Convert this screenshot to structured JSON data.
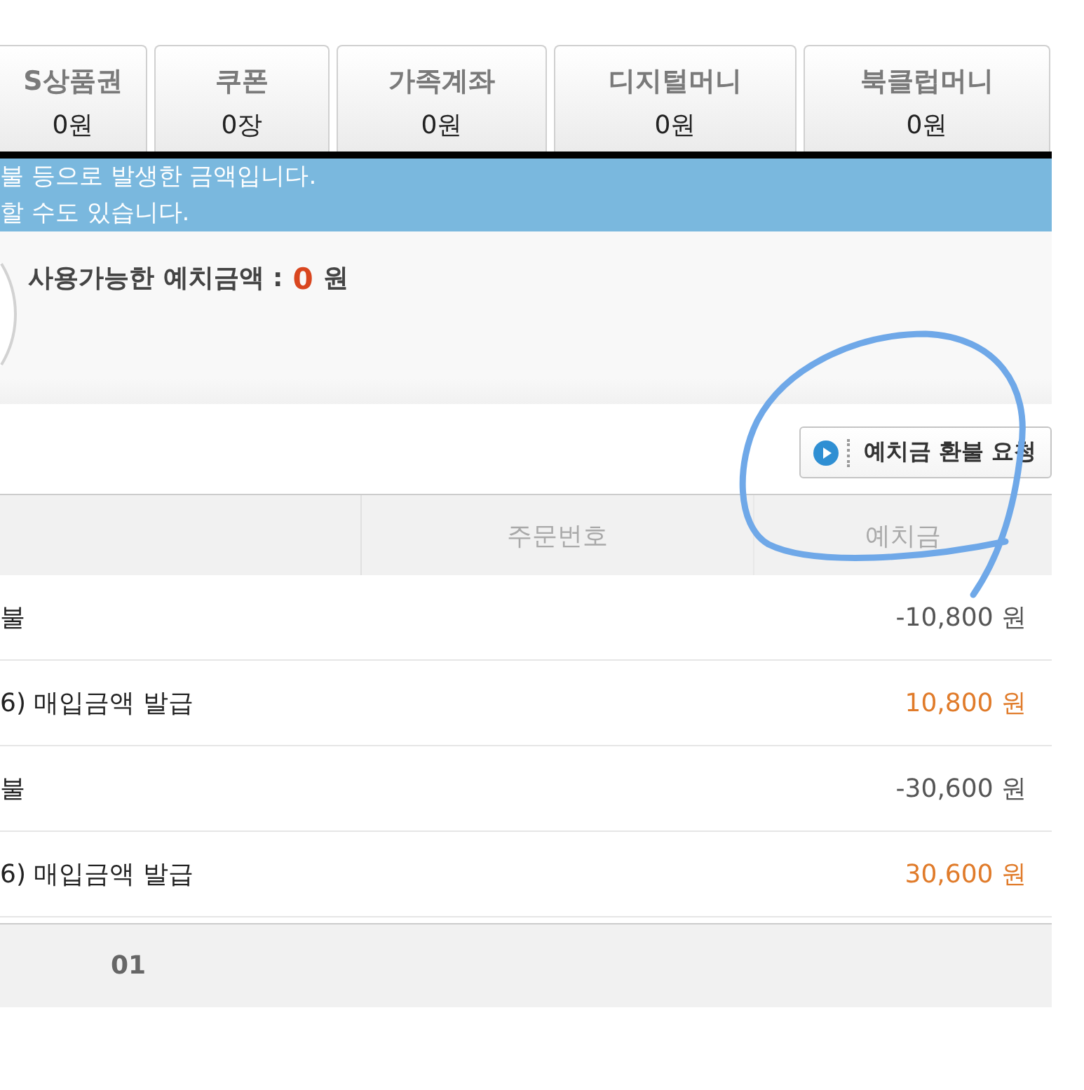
{
  "tabs": [
    {
      "label": "S상품권",
      "value": "0원",
      "selected": false
    },
    {
      "label": "쿠폰",
      "value": "0장",
      "selected": false
    },
    {
      "label": "가족계좌",
      "value": "0원",
      "selected": false
    },
    {
      "label": "디지털머니",
      "value": "0원",
      "selected": false
    },
    {
      "label": "북클럽머니",
      "value": "0원",
      "selected": false
    }
  ],
  "notice": {
    "lines": [
      "불 등으로 발생한 금액입니다.",
      "할 수도 있습니다."
    ]
  },
  "balance": {
    "label": "사용가능한 예치금액 :",
    "amount": "0",
    "unit": "원"
  },
  "refund_button": {
    "label": "예치금 환불 요청"
  },
  "table": {
    "columns": [
      "주문번호",
      "예치금"
    ],
    "rows": [
      {
        "column_1": "불",
        "amount": "-10,800 원",
        "color": "#555555"
      },
      {
        "column_1": "6) 매입금액 발급",
        "amount": "10,800 원",
        "color": "#e07b2a"
      },
      {
        "column_1": "불",
        "amount": "-30,600 원",
        "color": "#555555"
      },
      {
        "column_1": "6) 매입금액 발급",
        "amount": "30,600 원",
        "color": "#e07b2a"
      }
    ]
  },
  "pagination": {
    "pages": [
      "01"
    ]
  }
}
